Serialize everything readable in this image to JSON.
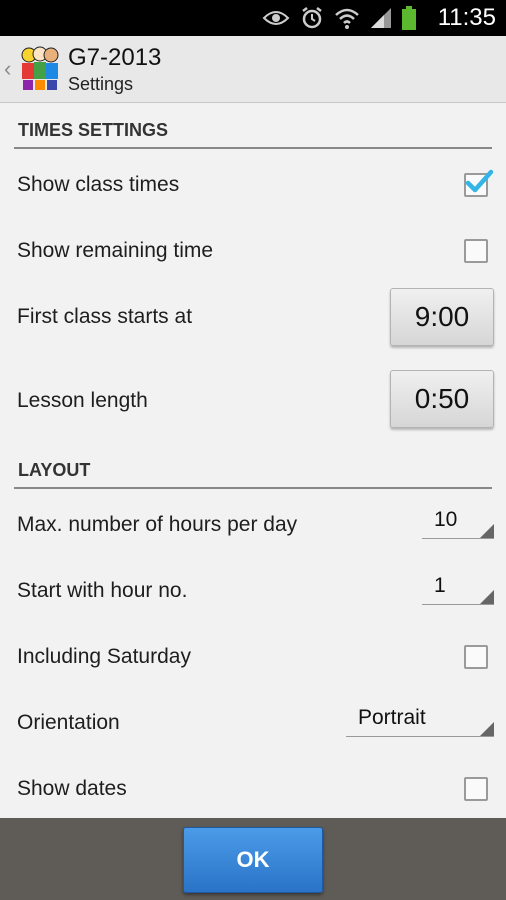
{
  "status_bar": {
    "time": "11:35",
    "icons": [
      "eye-icon",
      "alarm-icon",
      "wifi-icon",
      "signal-icon",
      "battery-icon"
    ],
    "battery_color": "#5cb82e"
  },
  "action_bar": {
    "title": "G7-2013",
    "subtitle": "Settings",
    "up_caret": "‹"
  },
  "sections": {
    "times": {
      "header": "TIMES SETTINGS",
      "show_class_times": {
        "label": "Show class times",
        "checked": true
      },
      "show_remaining_time": {
        "label": "Show remaining time",
        "checked": false
      },
      "first_class": {
        "label": "First class starts at",
        "value": "9:00"
      },
      "lesson_length": {
        "label": "Lesson length",
        "value": "0:50"
      }
    },
    "layout": {
      "header": "LAYOUT",
      "max_hours": {
        "label": "Max. number of hours per day",
        "value": "10"
      },
      "start_hour": {
        "label": "Start with hour no.",
        "value": "1"
      },
      "including_saturday": {
        "label": "Including Saturday",
        "checked": false
      },
      "orientation": {
        "label": "Orientation",
        "value": "Portrait"
      },
      "show_dates": {
        "label": "Show dates",
        "checked": false
      }
    }
  },
  "footer": {
    "ok_label": "OK"
  },
  "colors": {
    "accent": "#33b5e5",
    "ok_button": "#2f7fd3"
  }
}
